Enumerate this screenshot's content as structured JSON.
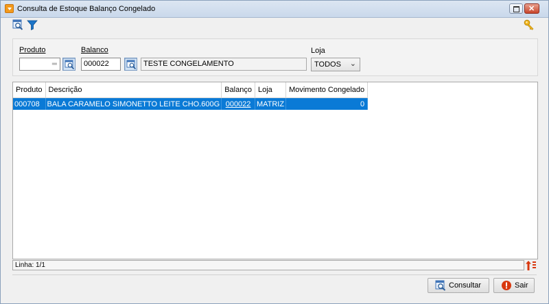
{
  "window": {
    "title": "Consulta de Estoque Balanço Congelado"
  },
  "toolbar": {
    "icons": [
      "search-window-icon",
      "filter-icon",
      "key-icon"
    ]
  },
  "criteria": {
    "produto": {
      "label": "Produto",
      "value": ""
    },
    "balanco": {
      "label": "Balanco",
      "value": "000022",
      "description": "TESTE CONGELAMENTO"
    },
    "loja": {
      "label": "Loja",
      "selected": "TODOS"
    }
  },
  "grid": {
    "columns": [
      "Produto",
      "Descrição",
      "Balanço",
      "Loja",
      "Movimento Congelado"
    ],
    "rows": [
      {
        "produto": "000708",
        "descricao": "BALA CARAMELO SIMONETTO LEITE CHO.600G",
        "balanco": "000022",
        "loja": "MATRIZ",
        "movimento": "0"
      }
    ],
    "selected_row_color": "#0a7ad6"
  },
  "status": {
    "linha": "Linha: 1/1"
  },
  "footer": {
    "consultar_label": "Consultar",
    "sair_label": "Sair"
  },
  "colors": {
    "accent": "#f39a1c",
    "selection": "#0a7ad6",
    "exit": "#d8380f"
  }
}
